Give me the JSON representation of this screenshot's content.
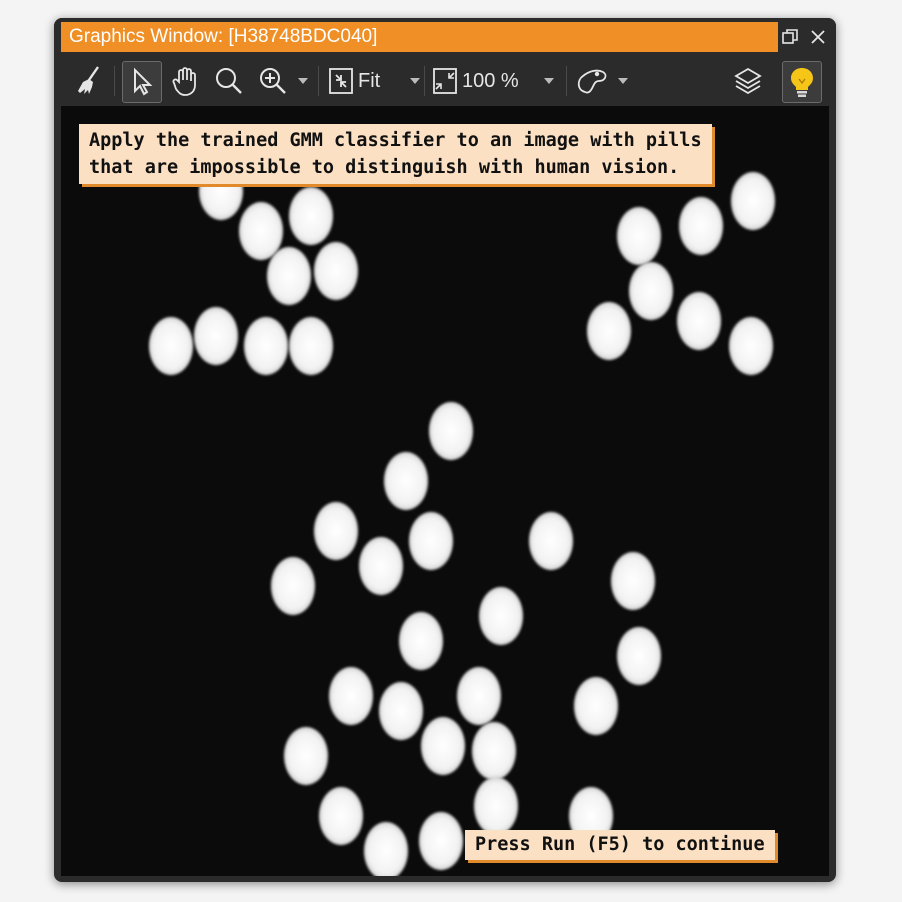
{
  "window": {
    "title": "Graphics Window: [H38748BDC040]"
  },
  "title_buttons": {
    "restore_icon": "restore-icon",
    "close_icon": "close-icon"
  },
  "toolbar": {
    "fit_label": "Fit",
    "zoom_value": "100 %",
    "icons": [
      "broom-icon",
      "pointer-icon",
      "hand-icon",
      "magnifier-icon",
      "zoom-in-icon",
      "fit-icon",
      "zoom-percent-icon",
      "shape-icon",
      "layers-icon",
      "lightbulb-icon"
    ]
  },
  "canvas": {
    "message": "Apply the trained GMM classifier to an image with pills\nthat are impossible to distinguish with human vision.",
    "continue_hint": "Press Run (F5) to continue"
  },
  "colors": {
    "title_orange": "#ef8f25",
    "window_bg": "#2b2b2b",
    "hint_bg": "#fbe0c4",
    "hint_shadow": "#e08a2c",
    "bulb_yellow": "#f5c518"
  }
}
